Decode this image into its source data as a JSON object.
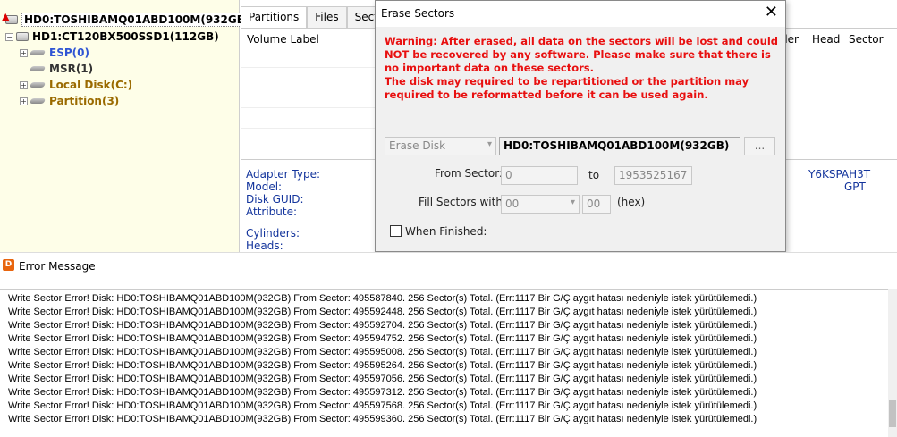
{
  "tree": {
    "disk0": "HD0:TOSHIBAMQ01ABD100M(932GB)",
    "disk1": "HD1:CT120BX500SSD1(112GB)",
    "partitions": [
      {
        "label": "ESP(0)",
        "color": "#2f55d4",
        "expander": "+"
      },
      {
        "label": "MSR(1)",
        "color": "#333333",
        "expander": ""
      },
      {
        "label": "Local Disk(C:)",
        "color": "#9a6a00",
        "expander": "+"
      },
      {
        "label": "Partition(3)",
        "color": "#9a6a00",
        "expander": "+"
      }
    ]
  },
  "main": {
    "tabs": [
      "Partitions",
      "Files",
      "Secto"
    ],
    "volume_label_header": "Volume Label",
    "col_der": "der",
    "col_head": "Head",
    "col_sector": "Sector",
    "info_labels": [
      "Adapter Type:",
      "Model:",
      "Disk GUID:",
      "Attribute:"
    ],
    "info_labels2": [
      "Cylinders:",
      "Heads:"
    ],
    "info_value1": "Y6KSPAH3T",
    "info_value2": "GPT"
  },
  "dialog": {
    "title": "Erase Sectors",
    "close_glyph": "✕",
    "warning": "Warning: After erased, all data on the sectors will be lost and could NOT be recovered by any software. Please make sure that there is no important data on these sectors.\nThe disk may required to be repartitioned or the partition may required to be reformatted before it can be used again.",
    "target_type": "Erase Disk",
    "target_name": "HD0:TOSHIBAMQ01ABD100M(932GB)",
    "browse_label": "...",
    "from_sector_label": "From Sector:",
    "from_sector_value": "0",
    "to_label": "to",
    "to_value": "1953525167",
    "fill_label": "Fill Sectors with:",
    "fill_value": "00",
    "fill_hex_value": "00",
    "hex_label": "(hex)",
    "when_finished_label": "When Finished:"
  },
  "error_window": {
    "title": "Error Message",
    "lines": [
      "Write Sector Error! Disk: HD0:TOSHIBAMQ01ABD100M(932GB) From Sector: 495587840. 256 Sector(s) Total. (Err:1117 Bir G/Ç aygıt hatası nedeniyle istek yürütülemedi.)",
      "Write Sector Error! Disk: HD0:TOSHIBAMQ01ABD100M(932GB) From Sector: 495592448. 256 Sector(s) Total. (Err:1117 Bir G/Ç aygıt hatası nedeniyle istek yürütülemedi.)",
      "Write Sector Error! Disk: HD0:TOSHIBAMQ01ABD100M(932GB) From Sector: 495592704. 256 Sector(s) Total. (Err:1117 Bir G/Ç aygıt hatası nedeniyle istek yürütülemedi.)",
      "Write Sector Error! Disk: HD0:TOSHIBAMQ01ABD100M(932GB) From Sector: 495594752. 256 Sector(s) Total. (Err:1117 Bir G/Ç aygıt hatası nedeniyle istek yürütülemedi.)",
      "Write Sector Error! Disk: HD0:TOSHIBAMQ01ABD100M(932GB) From Sector: 495595008. 256 Sector(s) Total. (Err:1117 Bir G/Ç aygıt hatası nedeniyle istek yürütülemedi.)",
      "Write Sector Error! Disk: HD0:TOSHIBAMQ01ABD100M(932GB) From Sector: 495595264. 256 Sector(s) Total. (Err:1117 Bir G/Ç aygıt hatası nedeniyle istek yürütülemedi.)",
      "Write Sector Error! Disk: HD0:TOSHIBAMQ01ABD100M(932GB) From Sector: 495597056. 256 Sector(s) Total. (Err:1117 Bir G/Ç aygıt hatası nedeniyle istek yürütülemedi.)",
      "Write Sector Error! Disk: HD0:TOSHIBAMQ01ABD100M(932GB) From Sector: 495597312. 256 Sector(s) Total. (Err:1117 Bir G/Ç aygıt hatası nedeniyle istek yürütülemedi.)",
      "Write Sector Error! Disk: HD0:TOSHIBAMQ01ABD100M(932GB) From Sector: 495597568. 256 Sector(s) Total. (Err:1117 Bir G/Ç aygıt hatası nedeniyle istek yürütülemedi.)",
      "Write Sector Error! Disk: HD0:TOSHIBAMQ01ABD100M(932GB) From Sector: 495599360. 256 Sector(s) Total. (Err:1117 Bir G/Ç aygıt hatası nedeniyle istek yürütülemedi.)"
    ]
  }
}
